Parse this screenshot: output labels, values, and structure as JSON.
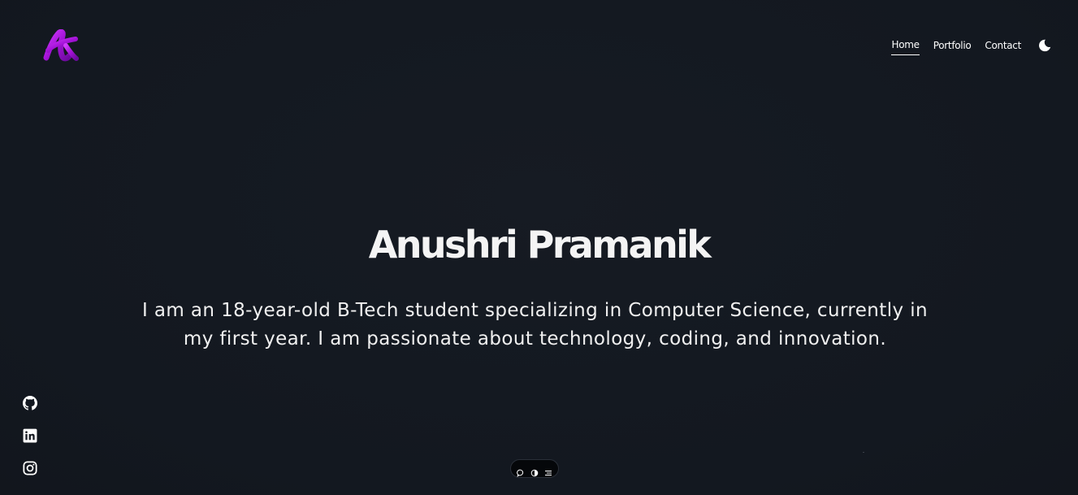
{
  "header": {
    "logo_icon": "brand-logo-icon",
    "nav": {
      "home": "Home",
      "portfolio": "Portfolio",
      "contact": "Contact"
    },
    "theme_toggle_icon": "moon-icon"
  },
  "hero": {
    "name": "Anushri Pramanik",
    "description": "I am an 18-year-old B-Tech student specializing in Computer Science, currently in my first year. I am passionate about technology, coding, and innovation."
  },
  "socials": [
    {
      "icon": "github-icon"
    },
    {
      "icon": "linkedin-icon"
    },
    {
      "icon": "instagram-icon"
    }
  ],
  "bottom_toolbar": {
    "icons": [
      "chat-icon",
      "toggle-icon",
      "menu-icon"
    ]
  },
  "colors": {
    "background": "#141820",
    "text": "#f2f2f2",
    "logo_accent": "#b31ae0"
  }
}
